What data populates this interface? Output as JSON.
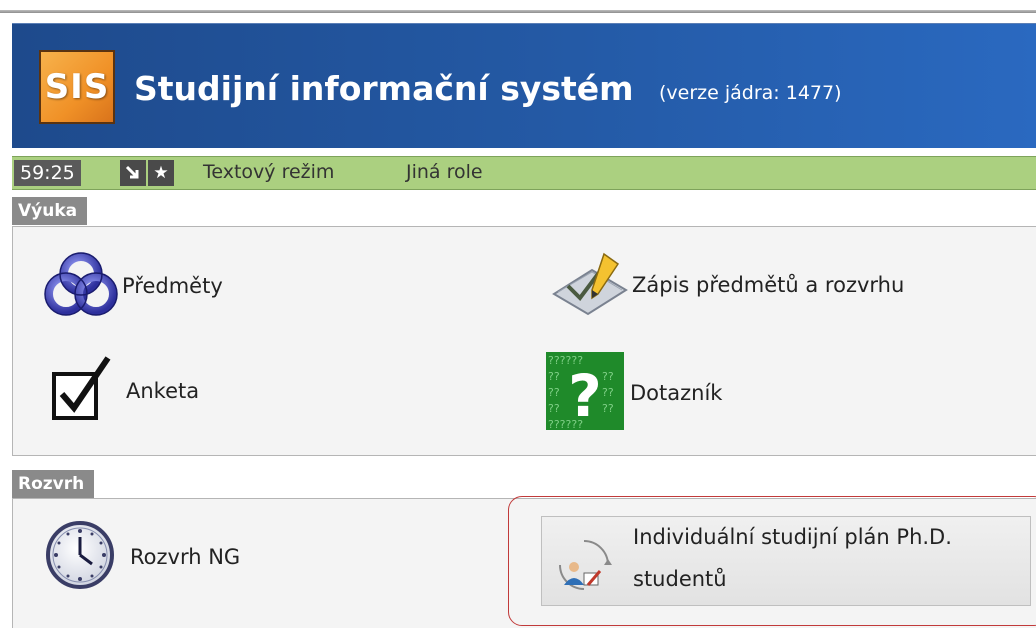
{
  "header": {
    "logo_text": "SIS",
    "title": "Studijní informační systém",
    "version": "(verze jádra: 1477)",
    "colors": {
      "header_blue": "#245aa6",
      "logo_orange": "#f09127"
    }
  },
  "statusbar": {
    "timer": "59:25",
    "text_mode": "Textový režim",
    "other_role": "Jiná role",
    "icons": [
      "expand-arrow-icon",
      "star-icon"
    ],
    "color": "#abd080"
  },
  "sections": {
    "vyuka": {
      "title": "Výuka",
      "items": {
        "predmety": {
          "label": "Předměty",
          "icon": "knot-icon"
        },
        "zapis": {
          "label": "Zápis předmětů a rozvrhu",
          "icon": "pencil-icon"
        },
        "anketa": {
          "label": "Anketa",
          "icon": "checkbox-icon"
        },
        "dotaznik": {
          "label": "Dotazník",
          "icon": "question-icon"
        }
      }
    },
    "rozvrh": {
      "title": "Rozvrh",
      "items": {
        "rozvrh_ng": {
          "label": "Rozvrh NG",
          "icon": "clock-icon"
        },
        "isp": {
          "label_line1": "Individuální studijní plán Ph.D.",
          "label_line2": "studentů",
          "icon": "study-plan-icon"
        }
      }
    }
  }
}
